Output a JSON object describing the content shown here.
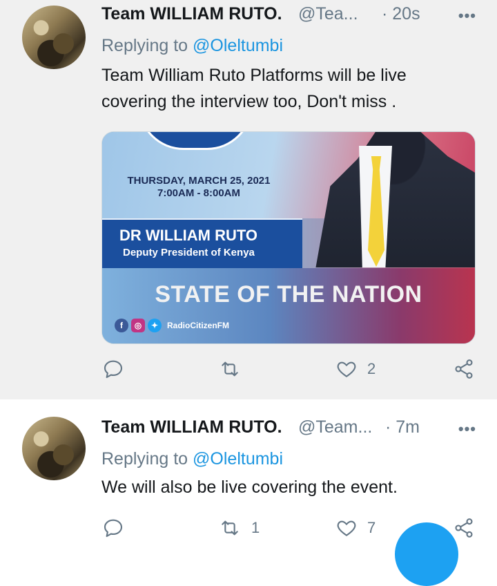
{
  "tweets": [
    {
      "name": "Team WILLIAM RUTO.",
      "handle": "@Tea...",
      "time": "· 20s",
      "reply_prefix": "Replying to",
      "reply_mention": "@Oleltumbi",
      "text": "Team William Ruto Platforms will be live covering the interview too, Don't miss .",
      "media": {
        "date": "THURSDAY, MARCH 25, 2021",
        "hours": "7:00AM - 8:00AM",
        "person_name": "DR WILLIAM RUTO",
        "person_role": "Deputy President of Kenya",
        "headline": "STATE OF THE NATION",
        "social_handle": "RadioCitizenFM"
      },
      "actions": {
        "replies": "",
        "retweets": "",
        "likes": "2"
      }
    },
    {
      "name": "Team WILLIAM RUTO.",
      "handle": "@Team...",
      "time": "· 7m",
      "reply_prefix": "Replying to",
      "reply_mention": "@Oleltumbi",
      "text": "We will also be live covering the event.",
      "actions": {
        "replies": "",
        "retweets": "1",
        "likes": "7"
      }
    }
  ],
  "icons": {
    "more": "•••",
    "reply": "reply-icon",
    "retweet": "retweet-icon",
    "like": "heart-icon",
    "share": "share-icon",
    "compose": "compose-fab"
  },
  "colors": {
    "accent": "#1da1f2",
    "mention": "#1b95e0",
    "muted": "#657786"
  }
}
